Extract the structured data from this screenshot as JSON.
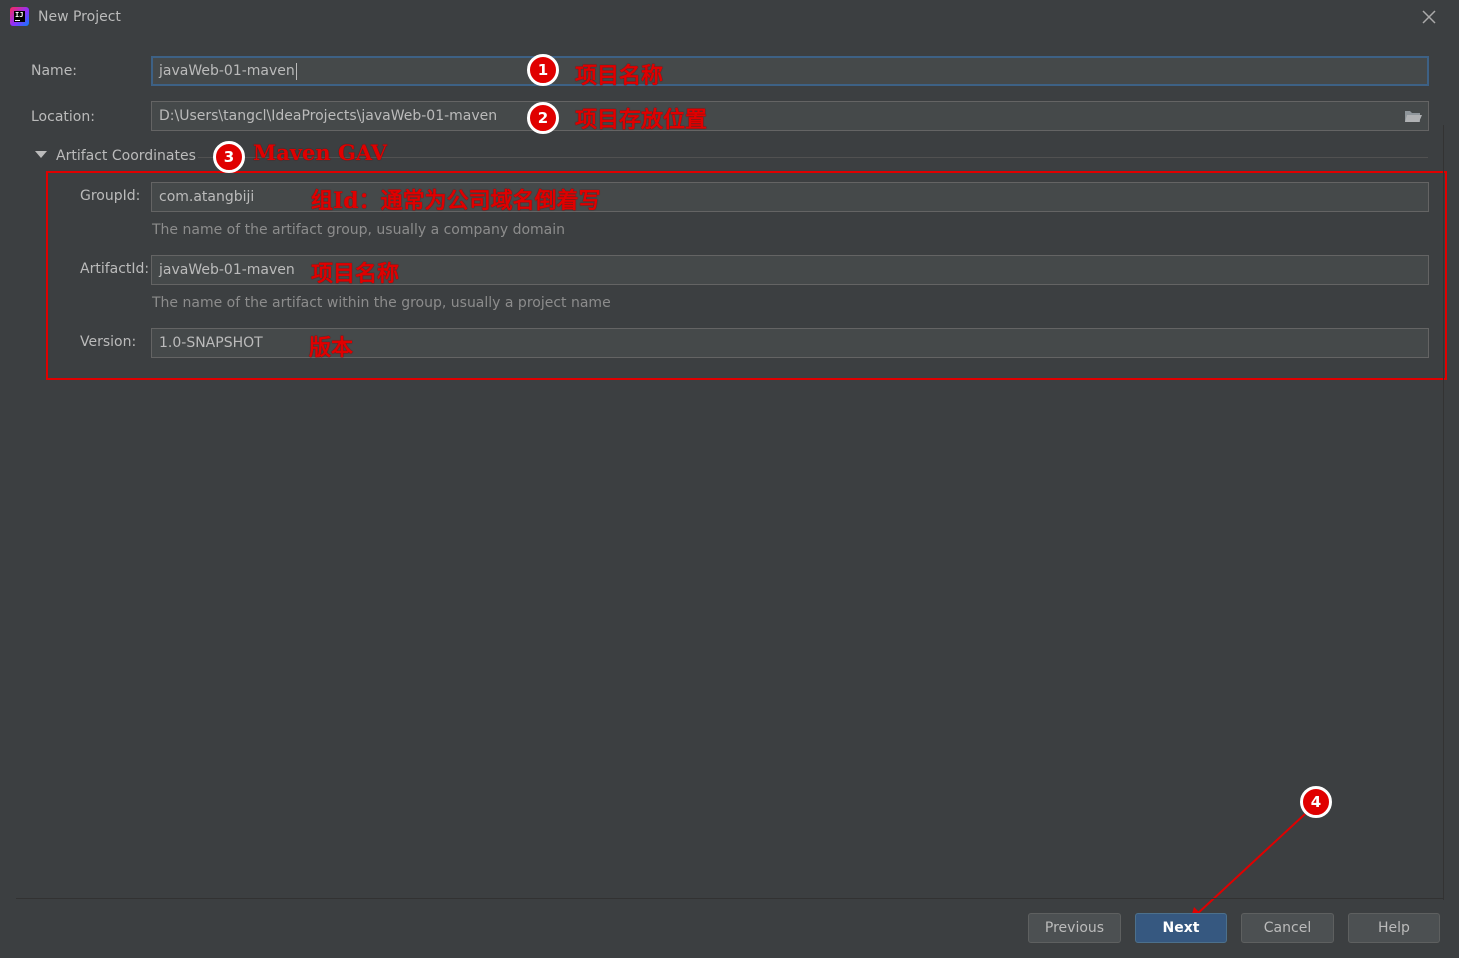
{
  "window": {
    "title": "New Project",
    "app_icon_text": "IJ"
  },
  "form": {
    "name_label": "Name:",
    "name_value": "javaWeb-01-maven",
    "location_label": "Location:",
    "location_value": "D:\\Users\\tangcl\\IdeaProjects\\javaWeb-01-maven",
    "section_title": "Artifact Coordinates",
    "groupid_label": "GroupId:",
    "groupid_value": "com.atangbiji",
    "groupid_hint": "The name of the artifact group, usually a company domain",
    "artifactid_label": "ArtifactId:",
    "artifactid_value": "javaWeb-01-maven",
    "artifactid_hint": "The name of the artifact within the group, usually a project name",
    "version_label": "Version:",
    "version_value": "1.0-SNAPSHOT"
  },
  "annotations": {
    "badge1": "1",
    "badge2": "2",
    "badge3": "3",
    "badge4": "4",
    "name_note": "项目名称",
    "location_note": "项目存放位置",
    "gav_note": "Maven GAV",
    "groupid_note": "组Id：通常为公司域名倒着写",
    "artifactid_note": "项目名称",
    "version_note": "版本",
    "color": "#e00000"
  },
  "buttons": {
    "previous": "Previous",
    "next": "Next",
    "cancel": "Cancel",
    "help": "Help"
  },
  "colors": {
    "background": "#3c3f41",
    "field": "#45494a",
    "primary_button": "#365880",
    "focus_border": "#3d6185"
  },
  "icons": [
    "app-icon",
    "close-icon",
    "folder-icon",
    "collapse-triangle-icon"
  ]
}
